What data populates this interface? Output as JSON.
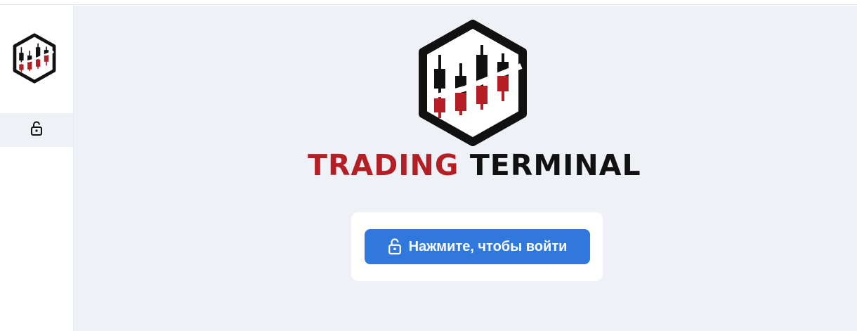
{
  "app": {
    "brand_part1": "TRADING",
    "brand_part2": "TERMINAL"
  },
  "sidebar": {
    "logo_icon": "candlestick-hexagon-logo",
    "items": [
      {
        "icon": "lock-open-icon",
        "label": ""
      }
    ]
  },
  "login": {
    "button_label": "Нажмите, чтобы войти",
    "button_icon": "lock-open-icon"
  },
  "colors": {
    "accent": "#3178dc",
    "brand_red": "#b41e25",
    "brand_dark": "#111111",
    "background": "#eef1f6"
  }
}
